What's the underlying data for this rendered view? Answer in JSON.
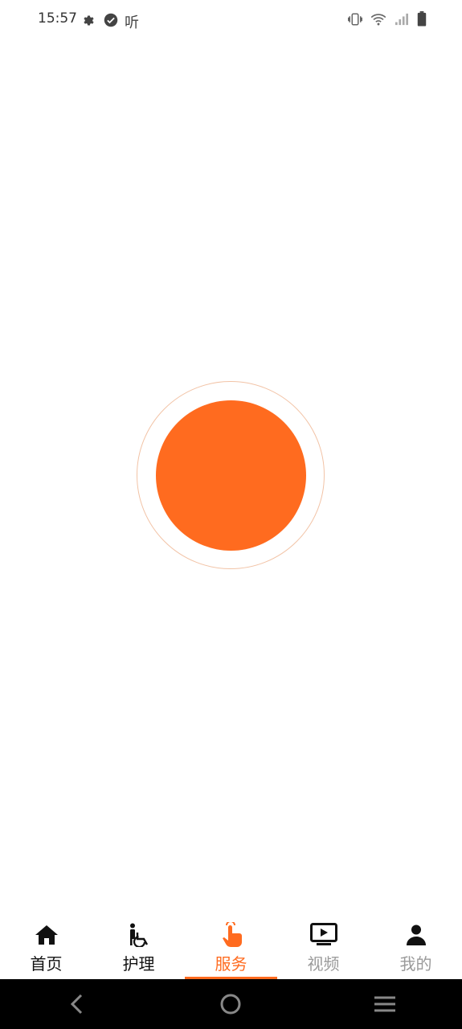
{
  "status_bar": {
    "time": "15:57",
    "listen_label": "听",
    "left_icons": [
      "gear-icon",
      "check-circle-icon"
    ],
    "right_icons": [
      "vibrate-icon",
      "wifi-icon",
      "signal-icon",
      "battery-icon"
    ]
  },
  "record": {
    "button_color": "#ff6b1f"
  },
  "tabs": [
    {
      "label": "首页",
      "icon": "home-icon",
      "state": "normal"
    },
    {
      "label": "护理",
      "icon": "wheelchair-icon",
      "state": "normal"
    },
    {
      "label": "服务",
      "icon": "tap-hand-icon",
      "state": "active"
    },
    {
      "label": "视频",
      "icon": "tv-play-icon",
      "state": "muted"
    },
    {
      "label": "我的",
      "icon": "person-icon",
      "state": "muted"
    }
  ],
  "nav": [
    "back-icon",
    "home-circle-icon",
    "menu-icon"
  ],
  "colors": {
    "accent": "#ff6b1f",
    "muted": "#9a9a9a"
  }
}
